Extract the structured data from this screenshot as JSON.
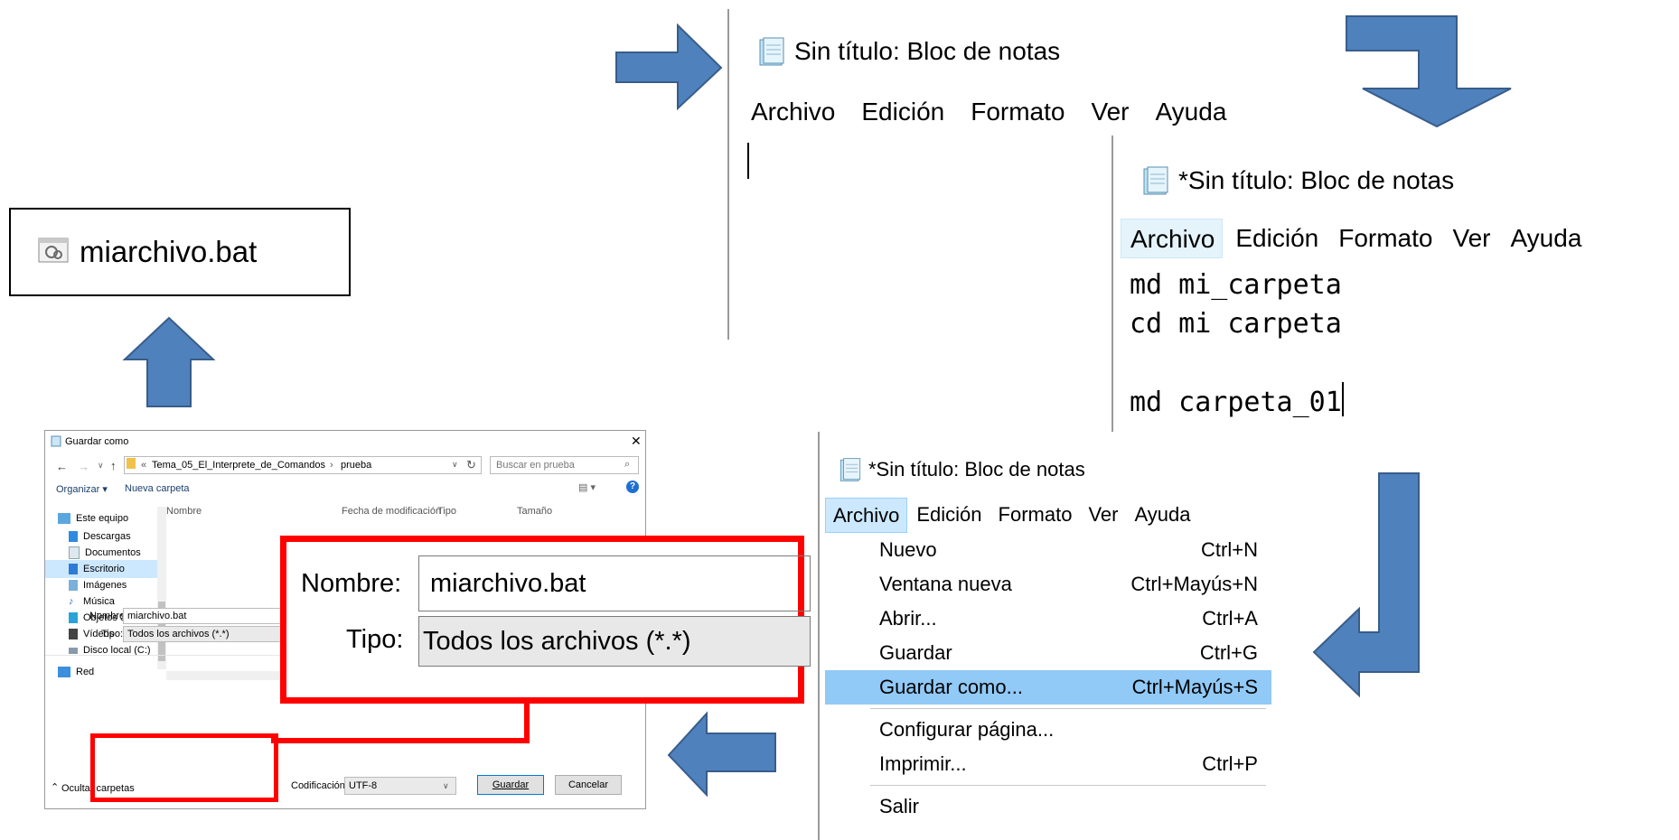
{
  "colors": {
    "arrow_fill": "#4f81bd",
    "arrow_stroke": "#385d8a",
    "highlight_red": "#ff0000",
    "menu_highlight": "#91c9f7"
  },
  "notepad_blank": {
    "title": "Sin título: Bloc de notas",
    "menu": [
      "Archivo",
      "Edición",
      "Formato",
      "Ver",
      "Ayuda"
    ],
    "icon": "notepad-icon"
  },
  "notepad_code": {
    "title": "*Sin título: Bloc de notas",
    "menu": [
      "Archivo",
      "Edición",
      "Formato",
      "Ver",
      "Ayuda"
    ],
    "active_menu": "Archivo",
    "lines": [
      "md mi_carpeta",
      "cd mi carpeta",
      "",
      "md carpeta_01"
    ],
    "icon": "notepad-icon"
  },
  "notepad_menu": {
    "title": "*Sin título: Bloc de notas",
    "menu": [
      "Archivo",
      "Edición",
      "Formato",
      "Ver",
      "Ayuda"
    ],
    "active_menu": "Archivo",
    "items": [
      {
        "label": "Nuevo",
        "shortcut": "Ctrl+N"
      },
      {
        "label": "Ventana nueva",
        "shortcut": "Ctrl+Mayús+N"
      },
      {
        "label": "Abrir...",
        "shortcut": "Ctrl+A"
      },
      {
        "label": "Guardar",
        "shortcut": "Ctrl+G"
      },
      {
        "label": "Guardar como...",
        "shortcut": "Ctrl+Mayús+S",
        "highlighted": true
      },
      {
        "label": "Configurar página...",
        "shortcut": ""
      },
      {
        "label": "Imprimir...",
        "shortcut": "Ctrl+P"
      },
      {
        "label": "Salir",
        "shortcut": ""
      }
    ]
  },
  "result_file": {
    "name": "miarchivo.bat",
    "icon": "batch-file-icon"
  },
  "save_dialog": {
    "title": "Guardar como",
    "path": [
      "Tema_05_El_Interprete_de_Comandos",
      "prueba"
    ],
    "path_prefix": "«",
    "search_placeholder": "Buscar en prueba",
    "organize": "Organizar ▾",
    "new_folder": "Nueva carpeta",
    "columns": [
      "Nombre",
      "Fecha de modificación",
      "Tipo",
      "Tamaño"
    ],
    "nav": [
      "Este equipo",
      "Descargas",
      "Documentos",
      "Escritorio",
      "Imágenes",
      "Música",
      "Objetos 3D",
      "Vídeos",
      "Disco local (C:)",
      "Red"
    ],
    "nav_selected": "Escritorio",
    "name_label": "Nombre:",
    "name_value": "miarchivo.bat",
    "type_label": "Tipo:",
    "type_value": "Todos los archivos  (*.*)",
    "hide_folders": "Ocultar carpetas",
    "encoding_label": "Codificación:",
    "encoding_value": "UTF-8",
    "save_button": "Guardar",
    "cancel_button": "Cancelar"
  },
  "zoom_detail": {
    "name_label": "Nombre:",
    "name_value": "miarchivo.bat",
    "type_label": "Tipo:",
    "type_value": "Todos los archivos  (*.*)"
  }
}
